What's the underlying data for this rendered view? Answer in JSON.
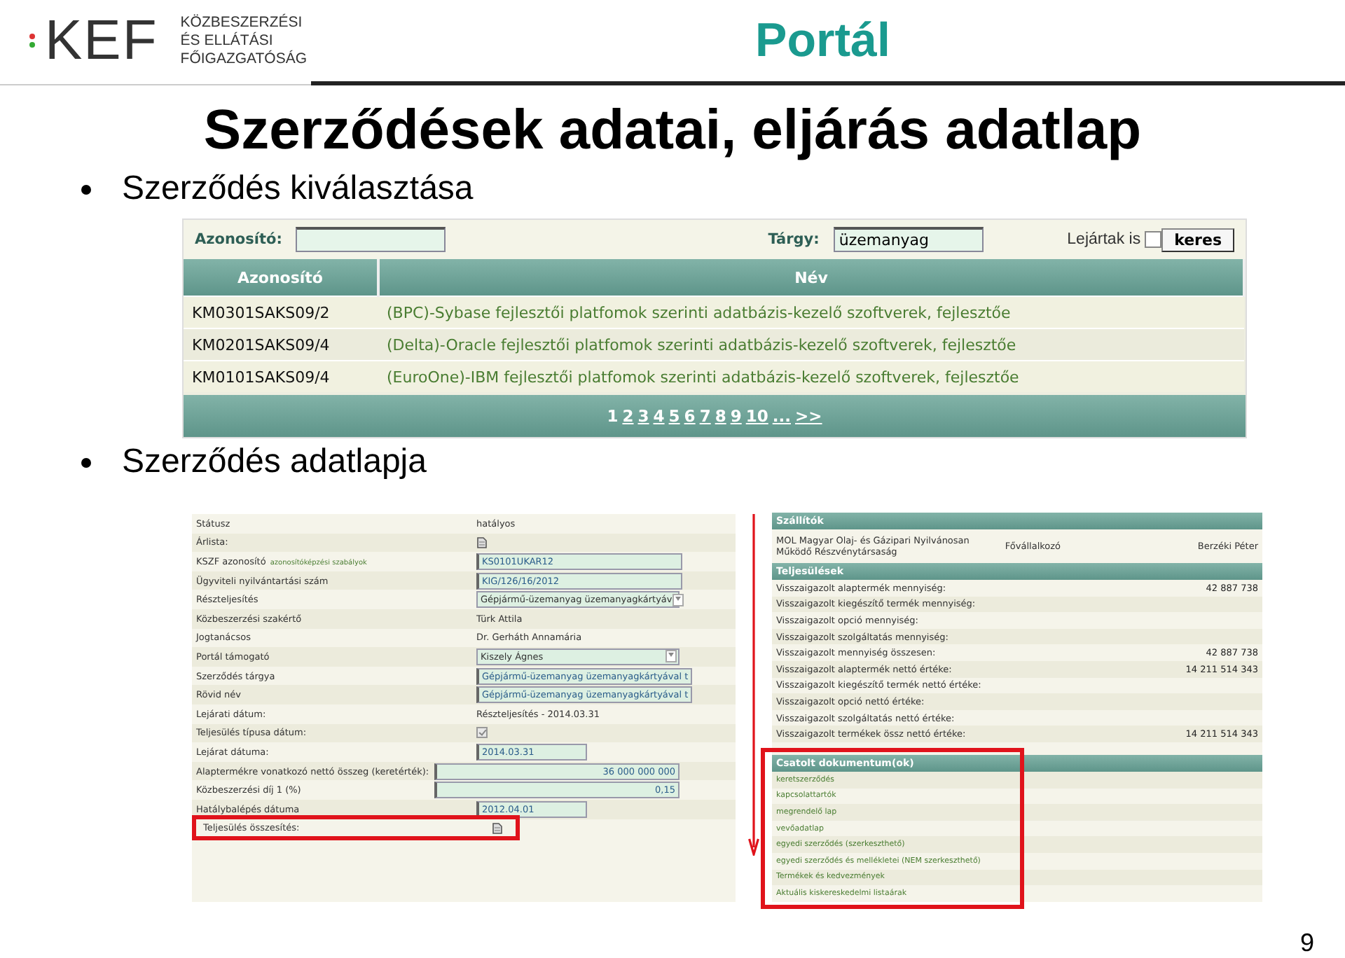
{
  "header": {
    "logo_mark": "KEF",
    "logo_caption": [
      "KÖZBESZERZÉSI",
      "ÉS ELLÁTÁSI",
      "FŐIGAZGATÓSÁG"
    ],
    "section": "Portál"
  },
  "title": "Szerződések adatai, eljárás adatlap",
  "bullets": [
    "Szerződés kiválasztása",
    "Szerződés adatlapja"
  ],
  "search_screen": {
    "fields": [
      {
        "label": "Azonosító:"
      },
      {
        "label": "Tárgy:",
        "value": "üzemanyag"
      }
    ],
    "expired_filter": {
      "label": "Lejártak is",
      "checked": false
    },
    "search_button": "keres",
    "table": {
      "columns": [
        "Azonosító",
        "Név"
      ],
      "rows": [
        [
          "KM0301SAKS09/2",
          "(BPC)-Sybase fejlesztői platfomok szerinti adatbázis-kezelő szoftverek, fejlesztőe"
        ],
        [
          "KM0201SAKS09/4",
          "(Delta)-Oracle fejlesztői platfomok szerinti adatbázis-kezelő szoftverek, fejlesztőe"
        ],
        [
          "KM0101SAKS09/4",
          "(EuroOne)-IBM fejlesztői platfomok szerinti adatbázis-kezelő szoftverek, fejlesztőe"
        ]
      ]
    },
    "pager": {
      "pages": [
        {
          "label": "1",
          "selected": true
        },
        {
          "label": "2",
          "selected": false
        },
        {
          "label": "3",
          "selected": false
        },
        {
          "label": "4",
          "selected": false
        },
        {
          "label": "5",
          "selected": false
        },
        {
          "label": "6",
          "selected": false
        },
        {
          "label": "7",
          "selected": false
        },
        {
          "label": "8",
          "selected": false
        },
        {
          "label": "9",
          "selected": false
        },
        {
          "label": "10",
          "selected": false
        }
      ],
      "more": "...",
      "next": ">>"
    }
  },
  "contract_form": {
    "rows": [
      {
        "kind": "text",
        "label": "Státusz",
        "value": "hatályos"
      },
      {
        "kind": "icon",
        "label": "Árlista:"
      },
      {
        "kind": "field",
        "label": "KSZF azonosító",
        "note": "azonosítóképzési szabályok",
        "value": "KS0101UKAR12"
      },
      {
        "kind": "field",
        "label": "Ügyviteli nyilvántartási szám",
        "value": "KIG/126/16/2012"
      },
      {
        "kind": "select",
        "label": "Részteljesítés",
        "value": "Gépjármű-üzemanyag üzemanyagkártyáv"
      },
      {
        "kind": "text",
        "label": "Közbeszerzési szakértő",
        "value": "Türk Attila"
      },
      {
        "kind": "text",
        "label": "Jogtanácsos",
        "value": "Dr. Gerháth Annamária"
      },
      {
        "kind": "select",
        "label": "Portál támogató",
        "value": "Kiszely Ágnes"
      },
      {
        "kind": "field",
        "label": "Szerződés tárgya",
        "value": "Gépjármű-üzemanyag üzemanyagkártyával t"
      },
      {
        "kind": "field",
        "label": "Rövid név",
        "value": "Gépjármű-üzemanyag üzemanyagkártyával t"
      },
      {
        "kind": "text",
        "label": "Lejárati dátum:",
        "value": "Részteljesítés - 2014.03.31"
      },
      {
        "kind": "checkbox",
        "label": "Teljesülés típusa dátum:",
        "checked": true
      },
      {
        "kind": "short-field",
        "label": "Lejárat dátuma:",
        "value": "2014.03.31"
      },
      {
        "kind": "number-field",
        "label": "Alaptermékre vonatkozó nettó összeg (keretérték):",
        "value": "36 000 000 000"
      },
      {
        "kind": "number-field",
        "label": "Közbeszerzési díj 1 (%)",
        "value": "0,15"
      },
      {
        "kind": "short-field",
        "label": "Hatálybalépés dátuma",
        "value": "2012.04.01"
      },
      {
        "kind": "icon",
        "label": "Teljesülés összesítés:",
        "highlighted": true
      }
    ]
  },
  "contract_side": {
    "suppliers": {
      "title": "Szállítók",
      "rows": [
        [
          "MOL Magyar Olaj- és Gázipari Nyilvánosan Működő Részvénytársaság",
          "Fővállalkozó",
          "Berzéki Péter"
        ]
      ]
    },
    "performance": {
      "title": "Teljesülések",
      "rows": [
        {
          "label": "Visszaigazolt alaptermék mennyiség:",
          "value": "42 887 738"
        },
        {
          "label": "Visszaigazolt kiegészítő termék mennyiség:"
        },
        {
          "label": "Visszaigazolt opció mennyiség:"
        },
        {
          "label": "Visszaigazolt szolgáltatás mennyiség:"
        },
        {
          "label": "Visszaigazolt mennyiség összesen:",
          "value": "42 887 738"
        },
        {
          "label": "Visszaigazolt alaptermék nettó értéke:",
          "value": "14 211 514 343"
        },
        {
          "label": "Visszaigazolt kiegészítő termék nettó értéke:"
        },
        {
          "label": "Visszaigazolt opció nettó értéke:"
        },
        {
          "label": "Visszaigazolt szolgáltatás nettó értéke:"
        },
        {
          "label": "Visszaigazolt termékek össz nettó értéke:",
          "value": "14 211 514 343"
        }
      ]
    },
    "documents": {
      "title": "Csatolt dokumentum(ok)",
      "highlighted": true,
      "items": [
        "keretszerződés",
        "kapcsolattartók",
        "megrendelő lap",
        "vevőadatlap",
        "egyedi szerződés (szerkeszthető)",
        "egyedi szerződés és mellékletei (NEM szerkeszthető)",
        "Termékek és kedvezmények",
        "Aktuális kiskereskedelmi listaárak"
      ]
    }
  },
  "page_number": "9"
}
